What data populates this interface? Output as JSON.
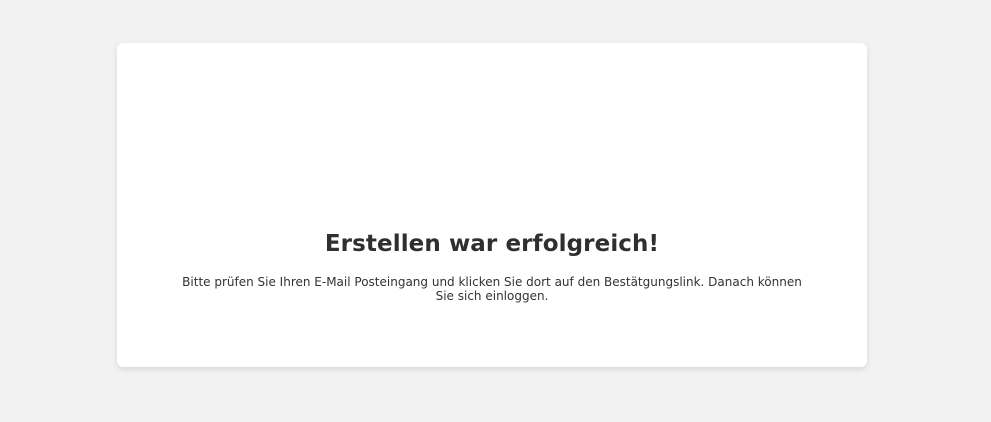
{
  "card": {
    "title": "Erstellen war erfolgreich!",
    "message": "Bitte prüfen Sie Ihren E-Mail Posteingang und klicken Sie dort auf den Bestätgungslink. Danach können Sie sich einloggen."
  },
  "colors": {
    "background": "#f2f2f2",
    "card": "#ffffff",
    "title": "#2f2f2f",
    "text": "#333333"
  }
}
